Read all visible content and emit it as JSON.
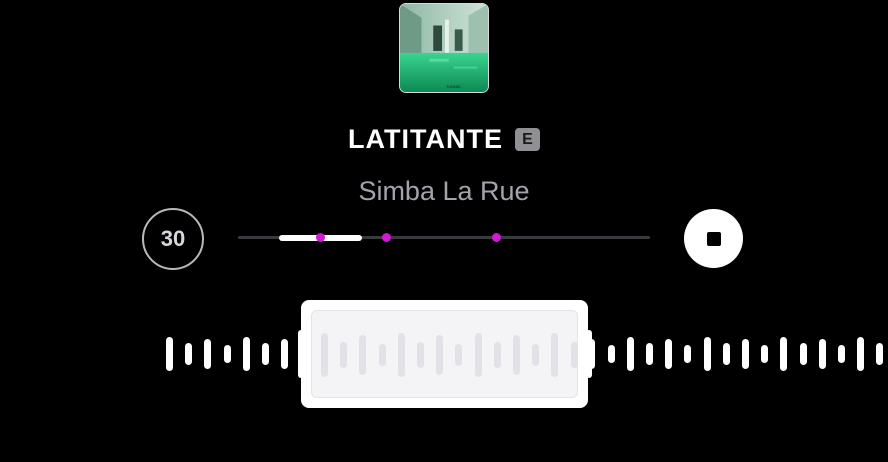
{
  "track": {
    "title": "LATITANTE",
    "explicit_badge": "E",
    "artist": "Simba La Rue",
    "artwork_text": "TUNNEL"
  },
  "controls": {
    "skip_label": "30",
    "progress_fraction": 0.3,
    "progress_start_fraction": 0.1,
    "markers": [
      0.2,
      0.36,
      0.628
    ]
  },
  "waveform": {
    "selection_start_fraction": 0.339,
    "selection_end_fraction": 0.662
  },
  "colors": {
    "background": "#000000",
    "marker": "#d21ad6",
    "artist_text": "#a3a3ab",
    "badge": "#8f8f94"
  }
}
